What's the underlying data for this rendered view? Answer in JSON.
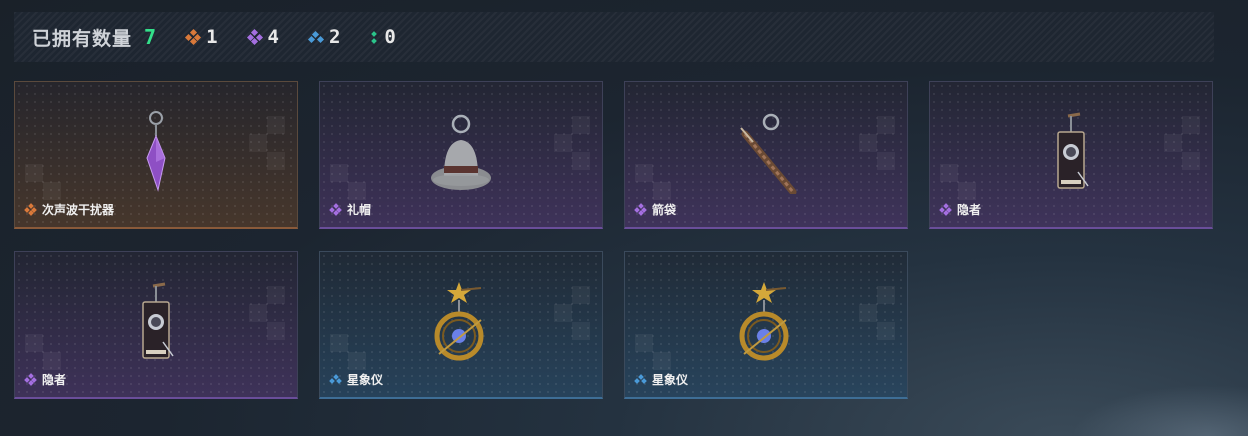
{
  "header": {
    "title": "已拥有数量",
    "total": "7",
    "stats": [
      {
        "icon": "orange-diamond-icon",
        "color": "#d9793a",
        "count": "1"
      },
      {
        "icon": "purple-diamond-icon",
        "color": "#a46fe0",
        "count": "4"
      },
      {
        "icon": "blue-triangle-icon",
        "color": "#4a9ad8",
        "count": "2"
      },
      {
        "icon": "green-dots-icon",
        "color": "#2bc48a",
        "count": "0"
      }
    ]
  },
  "items": [
    {
      "name": "次声波干扰器",
      "rarity": "orange",
      "rarity_icon": "orange-diamond-icon",
      "art": "purple-crystal-pendant"
    },
    {
      "name": "礼帽",
      "rarity": "purple",
      "rarity_icon": "purple-diamond-icon",
      "art": "gray-hat-charm"
    },
    {
      "name": "箭袋",
      "rarity": "purple",
      "rarity_icon": "purple-diamond-icon",
      "art": "quiver-charm"
    },
    {
      "name": "隐者",
      "rarity": "purple",
      "rarity_icon": "purple-diamond-icon",
      "art": "hermit-card-charm"
    },
    {
      "name": "隐者",
      "rarity": "purple",
      "rarity_icon": "purple-diamond-icon",
      "art": "hermit-card-charm"
    },
    {
      "name": "星象仪",
      "rarity": "blue",
      "rarity_icon": "blue-triangle-icon",
      "art": "astrolabe-charm"
    },
    {
      "name": "星象仪",
      "rarity": "blue",
      "rarity_icon": "blue-triangle-icon",
      "art": "astrolabe-charm"
    }
  ]
}
